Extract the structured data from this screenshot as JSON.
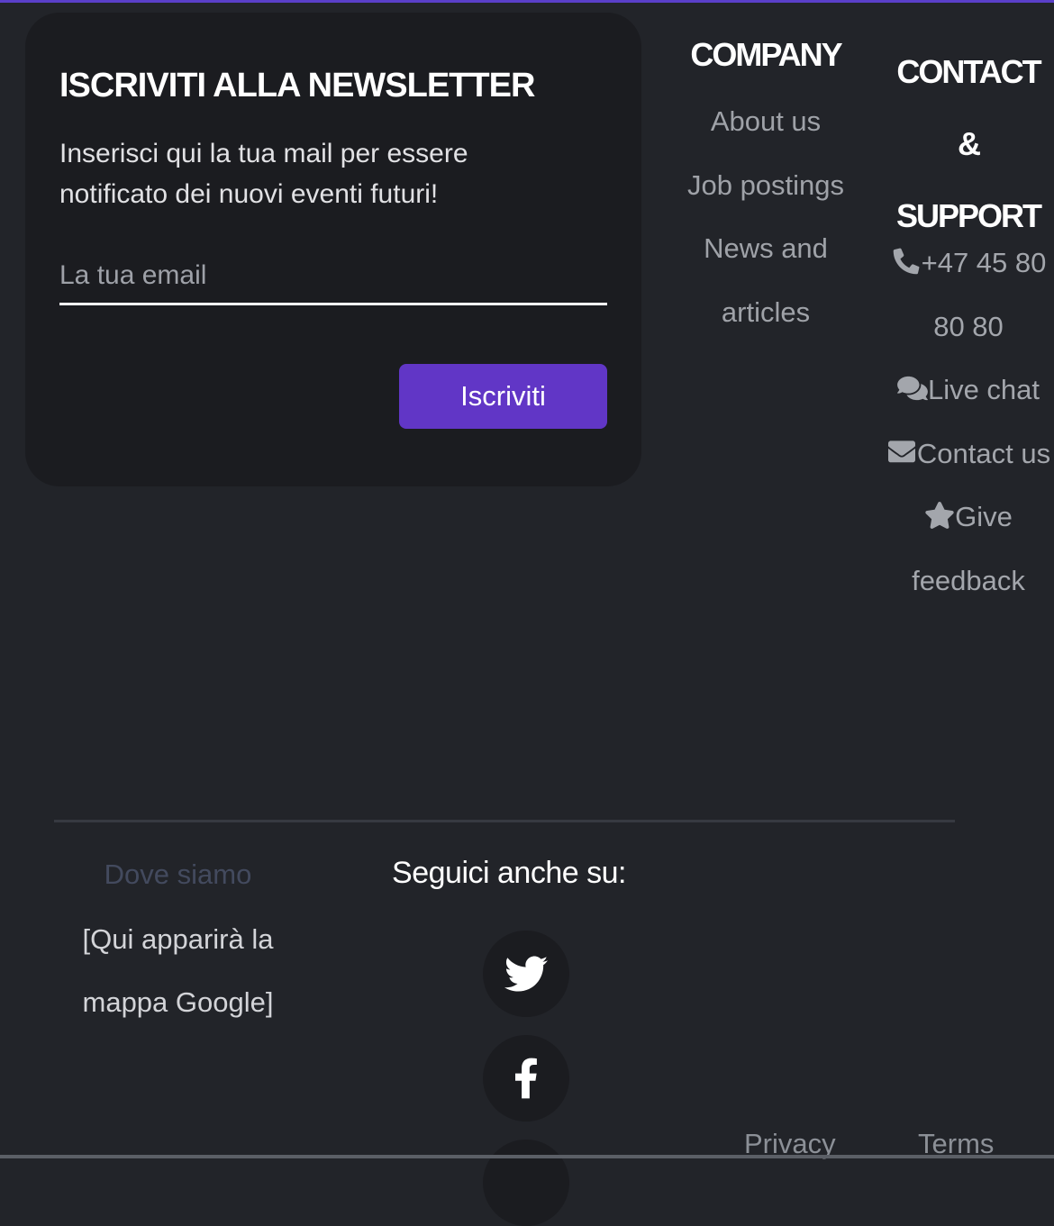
{
  "newsletter": {
    "title": "ISCRIVITI ALLA NEWSLETTER",
    "description": "Inserisci qui la tua mail per essere notificato dei nuovi eventi futuri!",
    "email_placeholder": "La tua email",
    "subscribe_label": "Iscriviti"
  },
  "company": {
    "heading": "COMPANY",
    "links": [
      "About us",
      "Job postings",
      "News and articles"
    ]
  },
  "contact": {
    "heading": "CONTACT & SUPPORT",
    "items": [
      {
        "icon": "phone-icon",
        "label": "+47 45 80 80 80"
      },
      {
        "icon": "chat-icon",
        "label": "Live chat"
      },
      {
        "icon": "envelope-icon",
        "label": "Contact us"
      },
      {
        "icon": "star-icon",
        "label": "Give feedback"
      }
    ]
  },
  "location": {
    "title": "Dove siamo",
    "map_placeholder": "[Qui apparirà la mappa Google]"
  },
  "social": {
    "title": "Seguici anche su:",
    "icons": [
      "twitter-icon",
      "facebook-icon"
    ]
  },
  "legal": {
    "privacy": "Privacy",
    "terms": "Terms"
  },
  "colors": {
    "background": "#222429",
    "card": "#1b1c20",
    "accent": "#6136c6"
  }
}
